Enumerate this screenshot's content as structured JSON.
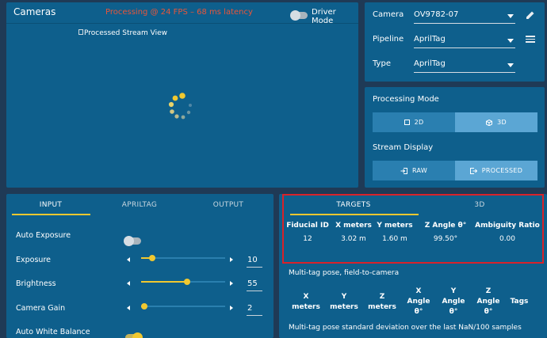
{
  "cameras_panel": {
    "title": "Cameras",
    "status": "Processing @ 24 FPS – 68 ms latency",
    "driver_mode_label": "Driver Mode",
    "stream_alt": "Processed Stream View"
  },
  "config": {
    "camera_label": "Camera",
    "camera_value": "OV9782-07",
    "pipeline_label": "Pipeline",
    "pipeline_value": "AprilTag",
    "type_label": "Type",
    "type_value": "AprilTag"
  },
  "modes": {
    "processing_mode_label": "Processing Mode",
    "mode_2d": "2D",
    "mode_3d": "3D",
    "stream_display_label": "Stream Display",
    "raw": "RAW",
    "processed": "PROCESSED"
  },
  "settings": {
    "tabs": [
      "INPUT",
      "APRILTAG",
      "OUTPUT"
    ],
    "auto_exposure": "Auto Exposure",
    "exposure": {
      "label": "Exposure",
      "value": "10",
      "level": 0.13
    },
    "brightness": {
      "label": "Brightness",
      "value": "55",
      "level": 0.55
    },
    "camera_gain": {
      "label": "Camera Gain",
      "value": "2",
      "level": 0.02
    },
    "auto_white_balance": "Auto White Balance"
  },
  "targets": {
    "tabs": [
      "TARGETS",
      "3D"
    ],
    "headers": [
      "Fiducial ID",
      "X meters",
      "Y meters",
      "Z Angle θ°",
      "Ambiguity Ratio"
    ],
    "row": [
      "12",
      "3.02 m",
      "1.60 m",
      "99.50°",
      "0.00"
    ],
    "multitag_label": "Multi-tag pose, field-to-camera",
    "multitag_headers": [
      [
        "X",
        "meters"
      ],
      [
        "Y",
        "meters"
      ],
      [
        "Z",
        "meters"
      ],
      [
        "X",
        "Angle",
        "θ°"
      ],
      [
        "Y",
        "Angle",
        "θ°"
      ],
      [
        "Z",
        "Angle",
        "θ°"
      ],
      [
        "Tags"
      ]
    ],
    "stddev_label": "Multi-tag pose standard deviation over the last NaN/100 samples"
  },
  "colors": {
    "accent": "#f0c830",
    "status": "#e8553a",
    "highlight": "#d8222a",
    "panel": "#0e5f8c",
    "background": "#1f3a56"
  }
}
